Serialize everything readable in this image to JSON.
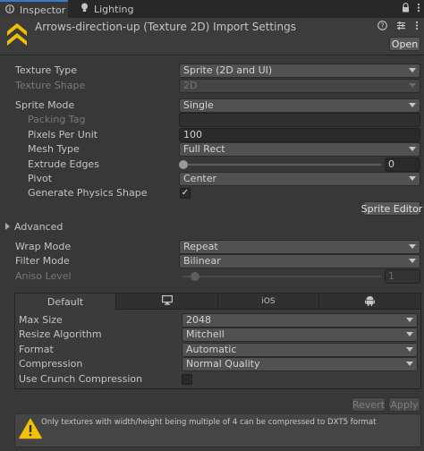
{
  "tabs": {
    "inspector": "Inspector",
    "lighting": "Lighting"
  },
  "header": {
    "title": "Arrows-direction-up (Texture 2D) Import Settings",
    "open_label": "Open",
    "icons": [
      "lock-icon",
      "kebab-menu-icon",
      "help-icon",
      "settings-sliders-icon"
    ]
  },
  "fields": {
    "texture_type": {
      "label": "Texture Type",
      "value": "Sprite (2D and UI)"
    },
    "texture_shape": {
      "label": "Texture Shape",
      "value": "2D"
    },
    "sprite_mode": {
      "label": "Sprite Mode",
      "value": "Single"
    },
    "packing_tag": {
      "label": "Packing Tag",
      "value": ""
    },
    "pixels_per_unit": {
      "label": "Pixels Per Unit",
      "value": "100"
    },
    "mesh_type": {
      "label": "Mesh Type",
      "value": "Full Rect"
    },
    "extrude_edges": {
      "label": "Extrude Edges",
      "value": "0",
      "slider_fraction": 0.0
    },
    "pivot": {
      "label": "Pivot",
      "value": "Center"
    },
    "generate_physics_shape": {
      "label": "Generate Physics Shape",
      "checked": true
    },
    "sprite_editor_label": "Sprite Editor",
    "advanced_label": "Advanced",
    "wrap_mode": {
      "label": "Wrap Mode",
      "value": "Repeat"
    },
    "filter_mode": {
      "label": "Filter Mode",
      "value": "Bilinear"
    },
    "aniso_level": {
      "label": "Aniso Level",
      "value": "1",
      "slider_fraction": 0.06
    }
  },
  "platform": {
    "tabs": [
      {
        "label": "Default",
        "icon": ""
      },
      {
        "label": "",
        "icon": "monitor-icon"
      },
      {
        "label": "iOS",
        "icon": ""
      },
      {
        "label": "",
        "icon": "android-icon"
      }
    ],
    "max_size": {
      "label": "Max Size",
      "value": "2048"
    },
    "resize_algorithm": {
      "label": "Resize Algorithm",
      "value": "Mitchell"
    },
    "format": {
      "label": "Format",
      "value": "Automatic"
    },
    "compression": {
      "label": "Compression",
      "value": "Normal Quality"
    },
    "use_crunch_compression": {
      "label": "Use Crunch Compression",
      "checked": false
    }
  },
  "actions": {
    "revert_label": "Revert",
    "apply_label": "Apply"
  },
  "warning": {
    "text": "Only textures with width/height being multiple of 4 can be compressed to DXT5 format"
  },
  "colors": {
    "accent_tab": "#3a79bb",
    "icon_yellow": "#f0c000",
    "warning_yellow": "#f2c200"
  }
}
